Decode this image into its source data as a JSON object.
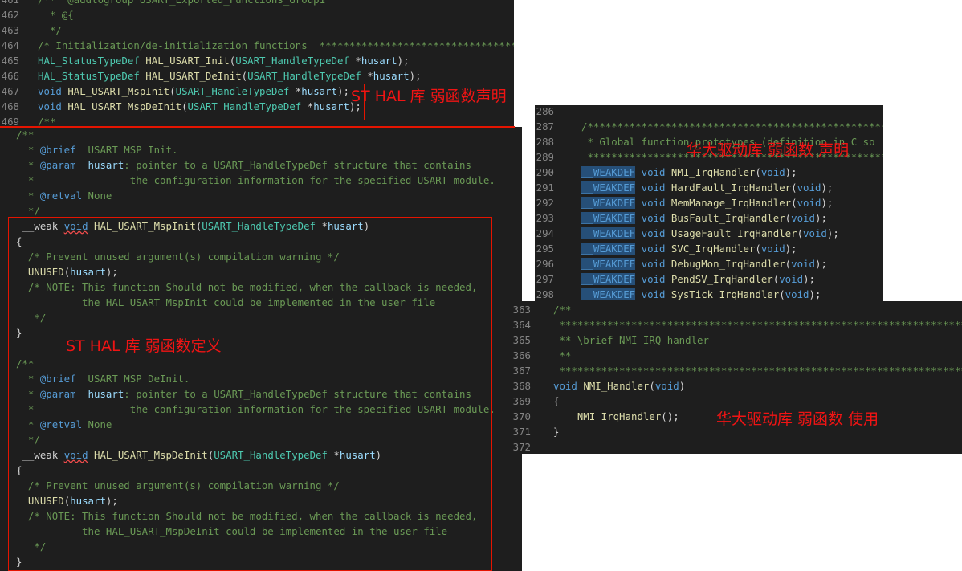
{
  "panel1": [
    {
      "n": "461",
      "s": [
        [
          "c",
          "/**  @addtogroup USART_Exported_Functions_Group1"
        ]
      ]
    },
    {
      "n": "462",
      "s": [
        [
          "c",
          "  * @{"
        ]
      ]
    },
    {
      "n": "463",
      "s": [
        [
          "c",
          "  */"
        ]
      ]
    },
    {
      "n": "464",
      "s": [
        [
          "c",
          "/* Initialization/de-initialization functions  **********************************"
        ]
      ]
    },
    {
      "n": "465",
      "s": [
        [
          "t",
          "HAL_StatusTypeDef"
        ],
        [
          "d",
          " "
        ],
        [
          "f",
          "HAL_USART_Init"
        ],
        [
          "d",
          "("
        ],
        [
          "t",
          "USART_HandleTypeDef"
        ],
        [
          "d",
          " *"
        ],
        [
          "p",
          "husart"
        ],
        [
          "d",
          ");"
        ]
      ]
    },
    {
      "n": "466",
      "s": [
        [
          "t",
          "HAL_StatusTypeDef"
        ],
        [
          "d",
          " "
        ],
        [
          "f",
          "HAL_USART_DeInit"
        ],
        [
          "d",
          "("
        ],
        [
          "t",
          "USART_HandleTypeDef"
        ],
        [
          "d",
          " *"
        ],
        [
          "p",
          "husart"
        ],
        [
          "d",
          ");"
        ]
      ]
    },
    {
      "n": "467",
      "s": [
        [
          "k",
          "void"
        ],
        [
          "d",
          " "
        ],
        [
          "f",
          "HAL_USART_MspInit"
        ],
        [
          "d",
          "("
        ],
        [
          "t",
          "USART_HandleTypeDef"
        ],
        [
          "d",
          " *"
        ],
        [
          "p",
          "husart"
        ],
        [
          "d",
          ");"
        ]
      ]
    },
    {
      "n": "468",
      "s": [
        [
          "k",
          "void"
        ],
        [
          "d",
          " "
        ],
        [
          "f",
          "HAL_USART_MspDeInit"
        ],
        [
          "d",
          "("
        ],
        [
          "t",
          "USART_HandleTypeDef"
        ],
        [
          "d",
          " *"
        ],
        [
          "p",
          "husart"
        ],
        [
          "d",
          ");"
        ]
      ]
    },
    {
      "n": "469",
      "s": [
        [
          "c",
          "/**"
        ]
      ]
    }
  ],
  "panel2": [
    {
      "s": [
        [
          "c",
          "/**"
        ]
      ]
    },
    {
      "s": [
        [
          "c",
          "  * "
        ],
        [
          "dk",
          "@brief"
        ],
        [
          "c",
          "  USART MSP Init."
        ]
      ]
    },
    {
      "s": [
        [
          "c",
          "  * "
        ],
        [
          "dk",
          "@param"
        ],
        [
          "c",
          "  "
        ],
        [
          "p",
          "husart"
        ],
        [
          "c",
          ": pointer to a USART_HandleTypeDef structure that contains"
        ]
      ]
    },
    {
      "s": [
        [
          "c",
          "  *                the configuration information for the specified USART module."
        ]
      ]
    },
    {
      "s": [
        [
          "c",
          "  * "
        ],
        [
          "dk",
          "@retval"
        ],
        [
          "c",
          " None"
        ]
      ]
    },
    {
      "s": [
        [
          "c",
          "  */"
        ]
      ]
    },
    {
      "s": [
        [
          "d",
          " __weak "
        ],
        [
          "k",
          "void"
        ],
        [
          "d",
          " "
        ],
        [
          "f",
          "HAL_USART_MspInit"
        ],
        [
          "d",
          "("
        ],
        [
          "t",
          "USART_HandleTypeDef"
        ],
        [
          "d",
          " *"
        ],
        [
          "p",
          "husart"
        ],
        [
          "d",
          ")"
        ]
      ]
    },
    {
      "s": [
        [
          "d",
          "{"
        ]
      ]
    },
    {
      "s": [
        [
          "c",
          "  /* Prevent unused argument(s) compilation warning */"
        ]
      ]
    },
    {
      "s": [
        [
          "d",
          "  "
        ],
        [
          "f",
          "UNUSED"
        ],
        [
          "d",
          "("
        ],
        [
          "p",
          "husart"
        ],
        [
          "d",
          ");"
        ]
      ]
    },
    {
      "s": [
        [
          "c",
          "  /* NOTE: This function Should not be modified, when the callback is needed,"
        ]
      ]
    },
    {
      "s": [
        [
          "c",
          "           the HAL_USART_MspInit could be implemented in the user file"
        ]
      ]
    },
    {
      "s": [
        [
          "c",
          "   */"
        ]
      ]
    },
    {
      "s": [
        [
          "d",
          "}"
        ]
      ]
    },
    {
      "s": [
        [
          "d",
          ""
        ]
      ]
    },
    {
      "s": [
        [
          "c",
          "/**"
        ]
      ]
    },
    {
      "s": [
        [
          "c",
          "  * "
        ],
        [
          "dk",
          "@brief"
        ],
        [
          "c",
          "  USART MSP DeInit."
        ]
      ]
    },
    {
      "s": [
        [
          "c",
          "  * "
        ],
        [
          "dk",
          "@param"
        ],
        [
          "c",
          "  "
        ],
        [
          "p",
          "husart"
        ],
        [
          "c",
          ": pointer to a USART_HandleTypeDef structure that contains"
        ]
      ]
    },
    {
      "s": [
        [
          "c",
          "  *                the configuration information for the specified USART module."
        ]
      ]
    },
    {
      "s": [
        [
          "c",
          "  * "
        ],
        [
          "dk",
          "@retval"
        ],
        [
          "c",
          " None"
        ]
      ]
    },
    {
      "s": [
        [
          "c",
          "  */"
        ]
      ]
    },
    {
      "s": [
        [
          "d",
          " __weak "
        ],
        [
          "k",
          "void"
        ],
        [
          "d",
          " "
        ],
        [
          "f",
          "HAL_USART_MspDeInit"
        ],
        [
          "d",
          "("
        ],
        [
          "t",
          "USART_HandleTypeDef"
        ],
        [
          "d",
          " *"
        ],
        [
          "p",
          "husart"
        ],
        [
          "d",
          ")"
        ]
      ]
    },
    {
      "s": [
        [
          "d",
          "{"
        ]
      ]
    },
    {
      "s": [
        [
          "c",
          "  /* Prevent unused argument(s) compilation warning */"
        ]
      ]
    },
    {
      "s": [
        [
          "d",
          "  "
        ],
        [
          "f",
          "UNUSED"
        ],
        [
          "d",
          "("
        ],
        [
          "p",
          "husart"
        ],
        [
          "d",
          ");"
        ]
      ]
    },
    {
      "s": [
        [
          "c",
          "  /* NOTE: This function Should not be modified, when the callback is needed,"
        ]
      ]
    },
    {
      "s": [
        [
          "c",
          "           the HAL_USART_MspDeInit could be implemented in the user file"
        ]
      ]
    },
    {
      "s": [
        [
          "c",
          "   */"
        ]
      ]
    },
    {
      "s": [
        [
          "d",
          "}"
        ]
      ]
    }
  ],
  "panel3": [
    {
      "n": "286",
      "s": [
        [
          "d",
          ""
        ]
      ]
    },
    {
      "n": "287",
      "s": [
        [
          "c",
          "/**********************************************************"
        ]
      ]
    },
    {
      "n": "288",
      "s": [
        [
          "c",
          " * Global function prototypes (definition in C so"
        ]
      ]
    },
    {
      "n": "289",
      "s": [
        [
          "c",
          " **********************************************************"
        ]
      ]
    },
    {
      "n": "290",
      "s": [
        [
          "w",
          "__WEAKDEF"
        ],
        [
          "d",
          " "
        ],
        [
          "k",
          "void"
        ],
        [
          "d",
          " "
        ],
        [
          "f",
          "NMI_IrqHandler"
        ],
        [
          "d",
          "("
        ],
        [
          "k",
          "void"
        ],
        [
          "d",
          ");"
        ]
      ]
    },
    {
      "n": "291",
      "s": [
        [
          "w",
          "__WEAKDEF"
        ],
        [
          "d",
          " "
        ],
        [
          "k",
          "void"
        ],
        [
          "d",
          " "
        ],
        [
          "f",
          "HardFault_IrqHandler"
        ],
        [
          "d",
          "("
        ],
        [
          "k",
          "void"
        ],
        [
          "d",
          ");"
        ]
      ]
    },
    {
      "n": "292",
      "s": [
        [
          "w",
          "__WEAKDEF"
        ],
        [
          "d",
          " "
        ],
        [
          "k",
          "void"
        ],
        [
          "d",
          " "
        ],
        [
          "f",
          "MemManage_IrqHandler"
        ],
        [
          "d",
          "("
        ],
        [
          "k",
          "void"
        ],
        [
          "d",
          ");"
        ]
      ]
    },
    {
      "n": "293",
      "s": [
        [
          "w",
          "__WEAKDEF"
        ],
        [
          "d",
          " "
        ],
        [
          "k",
          "void"
        ],
        [
          "d",
          " "
        ],
        [
          "f",
          "BusFault_IrqHandler"
        ],
        [
          "d",
          "("
        ],
        [
          "k",
          "void"
        ],
        [
          "d",
          ");"
        ]
      ]
    },
    {
      "n": "294",
      "s": [
        [
          "w",
          "__WEAKDEF"
        ],
        [
          "d",
          " "
        ],
        [
          "k",
          "void"
        ],
        [
          "d",
          " "
        ],
        [
          "f",
          "UsageFault_IrqHandler"
        ],
        [
          "d",
          "("
        ],
        [
          "k",
          "void"
        ],
        [
          "d",
          ");"
        ]
      ]
    },
    {
      "n": "295",
      "s": [
        [
          "w",
          "__WEAKDEF"
        ],
        [
          "d",
          " "
        ],
        [
          "k",
          "void"
        ],
        [
          "d",
          " "
        ],
        [
          "f",
          "SVC_IrqHandler"
        ],
        [
          "d",
          "("
        ],
        [
          "k",
          "void"
        ],
        [
          "d",
          ");"
        ]
      ]
    },
    {
      "n": "296",
      "s": [
        [
          "w",
          "__WEAKDEF"
        ],
        [
          "d",
          " "
        ],
        [
          "k",
          "void"
        ],
        [
          "d",
          " "
        ],
        [
          "f",
          "DebugMon_IrqHandler"
        ],
        [
          "d",
          "("
        ],
        [
          "k",
          "void"
        ],
        [
          "d",
          ");"
        ]
      ]
    },
    {
      "n": "297",
      "s": [
        [
          "w",
          "__WEAKDEF"
        ],
        [
          "d",
          " "
        ],
        [
          "k",
          "void"
        ],
        [
          "d",
          " "
        ],
        [
          "f",
          "PendSV_IrqHandler"
        ],
        [
          "d",
          "("
        ],
        [
          "k",
          "void"
        ],
        [
          "d",
          ");"
        ]
      ]
    },
    {
      "n": "298",
      "s": [
        [
          "w",
          "__WEAKDEF"
        ],
        [
          "d",
          " "
        ],
        [
          "k",
          "void"
        ],
        [
          "d",
          " "
        ],
        [
          "f",
          "SysTick_IrqHandler"
        ],
        [
          "d",
          "("
        ],
        [
          "k",
          "void"
        ],
        [
          "d",
          ");"
        ]
      ]
    }
  ],
  "panel4": [
    {
      "n": "363",
      "s": [
        [
          "c",
          "/**"
        ]
      ]
    },
    {
      "n": "364",
      "s": [
        [
          "c",
          " *******************************************************************************"
        ]
      ]
    },
    {
      "n": "365",
      "s": [
        [
          "c",
          " ** \\brief NMI IRQ handler"
        ]
      ]
    },
    {
      "n": "366",
      "s": [
        [
          "c",
          " **"
        ]
      ]
    },
    {
      "n": "367",
      "s": [
        [
          "c",
          " *******************************************************************************"
        ]
      ]
    },
    {
      "n": "368",
      "s": [
        [
          "k",
          "void"
        ],
        [
          "d",
          " "
        ],
        [
          "f",
          "NMI_Handler"
        ],
        [
          "d",
          "("
        ],
        [
          "k",
          "void"
        ],
        [
          "d",
          ")"
        ]
      ]
    },
    {
      "n": "369",
      "s": [
        [
          "d",
          "{"
        ]
      ]
    },
    {
      "n": "370",
      "s": [
        [
          "d",
          "    "
        ],
        [
          "f",
          "NMI_IrqHandler"
        ],
        [
          "d",
          "();"
        ]
      ]
    },
    {
      "n": "371",
      "s": [
        [
          "d",
          "}"
        ]
      ]
    },
    {
      "n": "372",
      "s": [
        [
          "d",
          ""
        ]
      ]
    }
  ],
  "annotations": {
    "st_decl": "ST HAL 库 弱函数声明",
    "st_def": "ST HAL 库 弱函数定义",
    "hd_decl": "华大驱动库 弱函数 声明",
    "hd_use": "华大驱动库 弱函数 使用"
  },
  "colors": {
    "annotation": "#f01414",
    "background": "#1e1e1e"
  }
}
